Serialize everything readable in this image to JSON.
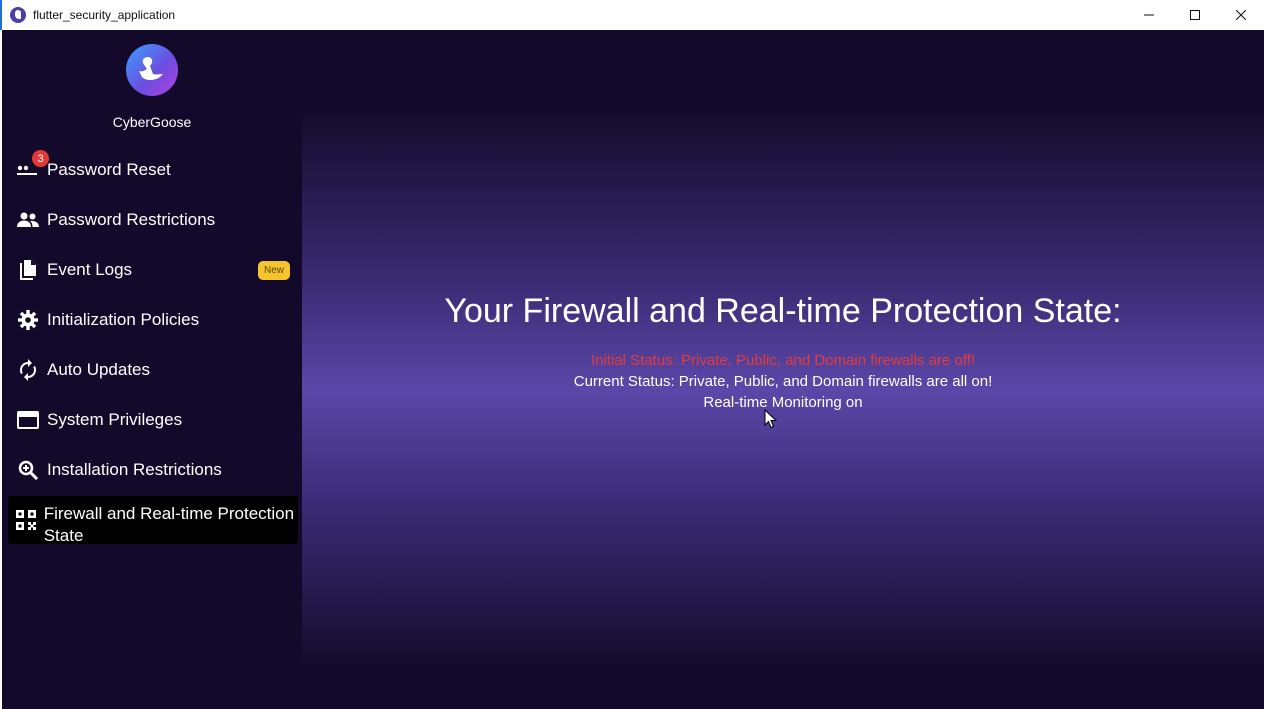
{
  "window": {
    "title": "flutter_security_application",
    "controls": [
      "minimize",
      "maximize",
      "close"
    ]
  },
  "brand": {
    "name": "CyberGoose",
    "logo_icon": "goose-logo-icon"
  },
  "sidebar": {
    "items": [
      {
        "label": "Password Reset",
        "icon": "password-dots-icon",
        "badge_count": "3"
      },
      {
        "label": "Password Restrictions",
        "icon": "people-icon"
      },
      {
        "label": "Event Logs",
        "icon": "documents-icon",
        "badge": "New"
      },
      {
        "label": "Initialization Policies",
        "icon": "gear-icon"
      },
      {
        "label": "Auto Updates",
        "icon": "refresh-icon"
      },
      {
        "label": "System Privileges",
        "icon": "card-icon"
      },
      {
        "label": "Installation Restrictions",
        "icon": "magnify-icon"
      },
      {
        "label": "Firewall and Real-time Protection State",
        "icon": "qr-code-icon",
        "active": true
      }
    ]
  },
  "main": {
    "title": "Your Firewall and Real-time Protection State:",
    "initial_status": "Initial Status: Private, Public, and Domain firewalls are off!",
    "current_status": "Current Status: Private, Public, and Domain firewalls are all on!",
    "monitoring": "Real-time Monitoring on"
  },
  "colors": {
    "background": "#130a2b",
    "active_item": "#000000",
    "error_text": "#e23b3b",
    "badge_new": "#f6c42c",
    "badge_count": "#e53935"
  }
}
